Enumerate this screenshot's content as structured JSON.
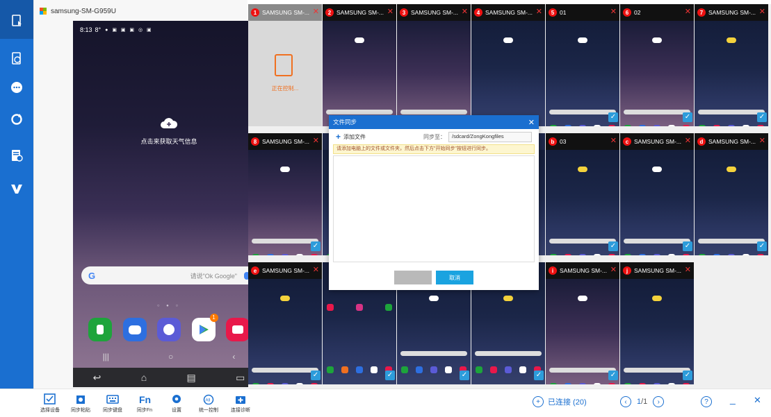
{
  "device": {
    "name": "samsung-SM-G959U",
    "status_time": "8:13",
    "status_temp": "8°",
    "weather_text": "点击来获取天气信息",
    "search_hint": "请说\"Ok Google\"",
    "play_badge": "1"
  },
  "tiles": [
    {
      "num": "1",
      "title": "SAMSUNG SM-...",
      "state": "controlling",
      "status": "正在控制..."
    },
    {
      "num": "2",
      "title": "SAMSUNG SM-..."
    },
    {
      "num": "3",
      "title": "SAMSUNG SM-..."
    },
    {
      "num": "4",
      "title": "SAMSUNG SM-..."
    },
    {
      "num": "5",
      "title": "01"
    },
    {
      "num": "6",
      "title": "02"
    },
    {
      "num": "7",
      "title": "SAMSUNG SM-..."
    },
    {
      "num": "8",
      "title": "SAMSUNG SM-..."
    },
    {
      "num": "b",
      "title": "03"
    },
    {
      "num": "c",
      "title": "SAMSUNG SM-..."
    },
    {
      "num": "d",
      "title": "SAMSUNG SM-..."
    },
    {
      "num": "e",
      "title": "SAMSUNG SM-..."
    },
    {
      "num": "i",
      "title": "SAMSUNG SM-..."
    },
    {
      "num": "j",
      "title": "SAMSUNG SM-..."
    }
  ],
  "dialog": {
    "title": "文件同步",
    "add_file": "添加文件",
    "sync_label": "同步至：",
    "sync_path": "/sdcard/ZongKongfiles",
    "tip": "请添加电脑上的文件或文件夹，然后点击下方\"开始同步\"按钮进行同步。",
    "cancel": "取消"
  },
  "toolbar": {
    "select_device": "选择设备",
    "sync_clipboard": "同步粘贴",
    "sync_keyboard": "同步键盘",
    "sync_fn": "同步Fn",
    "settings": "设置",
    "unified_control": "统一控制",
    "diagnose": "连接诊断"
  },
  "status": {
    "connected": "已连接 (20)",
    "page_current": "1",
    "page_total": "/1"
  },
  "colors": {
    "accent": "#1a6fd0",
    "badge": "#e11111",
    "controlling": "#f07020"
  }
}
